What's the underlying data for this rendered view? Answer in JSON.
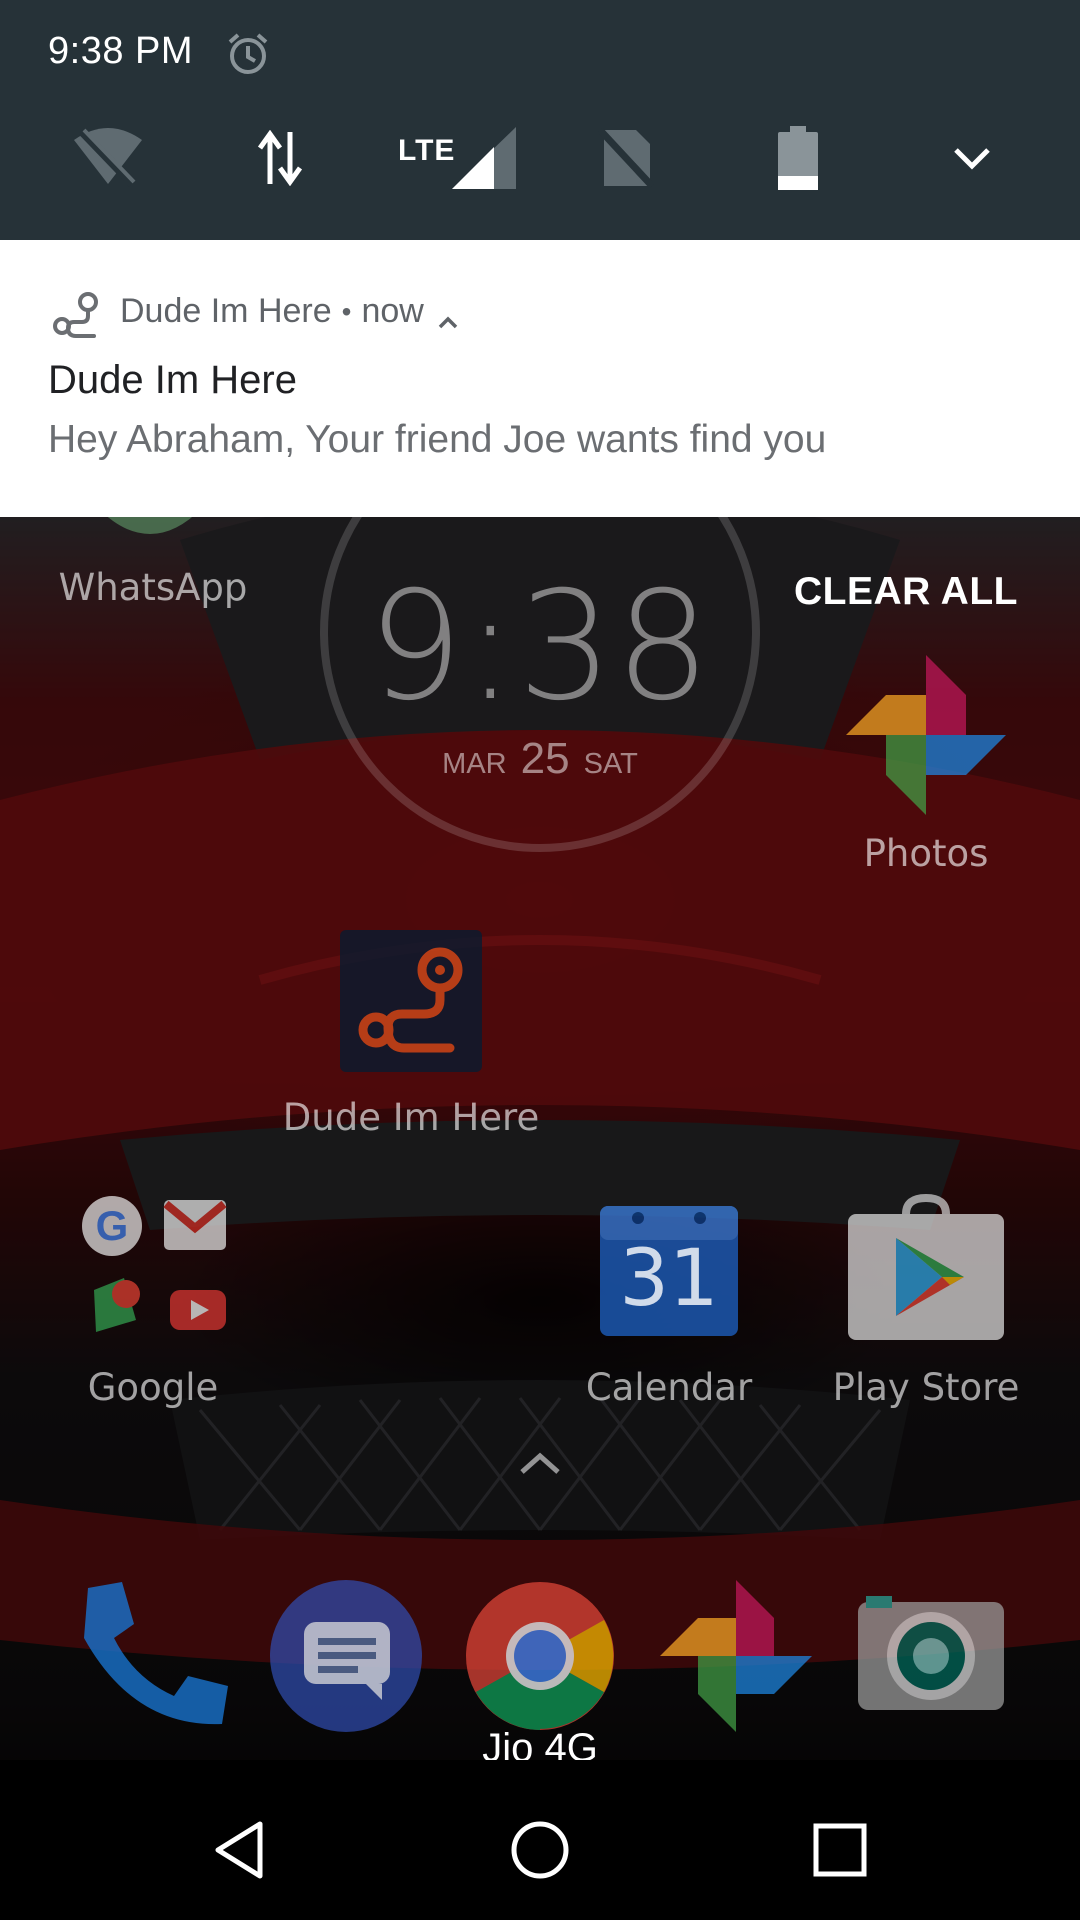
{
  "status_bar": {
    "time": "9:38 PM",
    "network_label": "LTE"
  },
  "quick_settings": {
    "icons": [
      "wifi-off-icon",
      "data-transfer-icon",
      "lte-signal-icon",
      "no-sim-icon",
      "battery-icon",
      "expand-chevron-icon"
    ]
  },
  "notification": {
    "app_name": "Dude Im Here",
    "separator": "•",
    "time": "now",
    "title": "Dude Im Here",
    "text": "Hey Abraham, Your friend Joe wants find you"
  },
  "home": {
    "clear_all": "CLEAR ALL",
    "clock": {
      "time": "9:38",
      "month": "MAR",
      "day": "25",
      "weekday": "SAT"
    },
    "apps": {
      "whatsapp": "WhatsApp",
      "photos": "Photos",
      "dude": "Dude Im Here",
      "google": "Google",
      "calendar": "Calendar",
      "calendar_date": "31",
      "play_store": "Play Store"
    },
    "dock_carrier": "Jio 4G"
  },
  "colors": {
    "qs_background": "#263238",
    "notification_bg": "#ffffff",
    "dude_icon_bg": "#0d1a2e",
    "dude_icon_fg": "#e8541c"
  }
}
